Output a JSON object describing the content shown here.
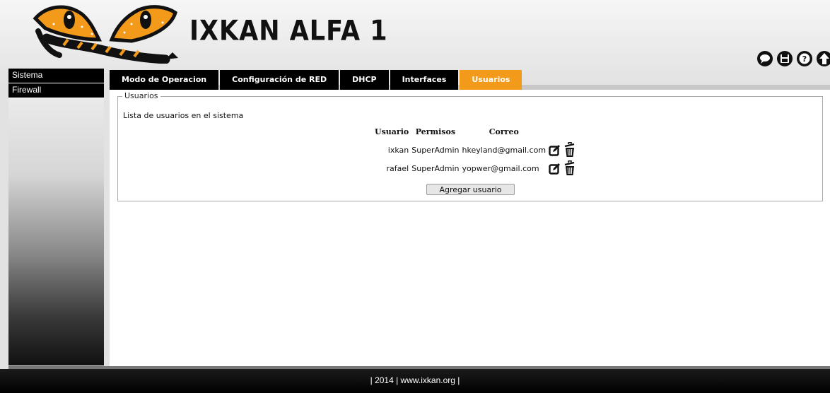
{
  "app": {
    "title": "IXKAN ALFA 1"
  },
  "toolbar": {
    "items": [
      {
        "icon": "chat-bubble-icon"
      },
      {
        "icon": "save-disk-icon"
      },
      {
        "icon": "help-icon"
      },
      {
        "icon": "arrow-up-icon"
      }
    ]
  },
  "sidebar": {
    "items": [
      {
        "label": "Sistema"
      },
      {
        "label": "Firewall"
      }
    ]
  },
  "tabs": [
    {
      "label": "Modo de Operacion",
      "active": false
    },
    {
      "label": "Configuración de RED",
      "active": false
    },
    {
      "label": "DHCP",
      "active": false
    },
    {
      "label": "Interfaces",
      "active": false
    },
    {
      "label": "Usuarios",
      "active": true
    }
  ],
  "users": {
    "legend": "Usuarios",
    "caption": "Lista de usuarios en el sistema",
    "columns": [
      "Usuario",
      "Permisos",
      "Correo"
    ],
    "rows": [
      {
        "usuario": "ixkan",
        "permisos": "SuperAdmin",
        "correo": "hkeyland@gmail.com"
      },
      {
        "usuario": "rafael",
        "permisos": "SuperAdmin",
        "correo": "yopwer@gmail.com"
      }
    ],
    "add_button": "Agregar usuario"
  },
  "footer": {
    "text": "| 2014 | www.ixkan.org |"
  },
  "colors": {
    "accent": "#f39a1a",
    "tab_bg": "#000000",
    "sidebar_bg": "#000000"
  }
}
